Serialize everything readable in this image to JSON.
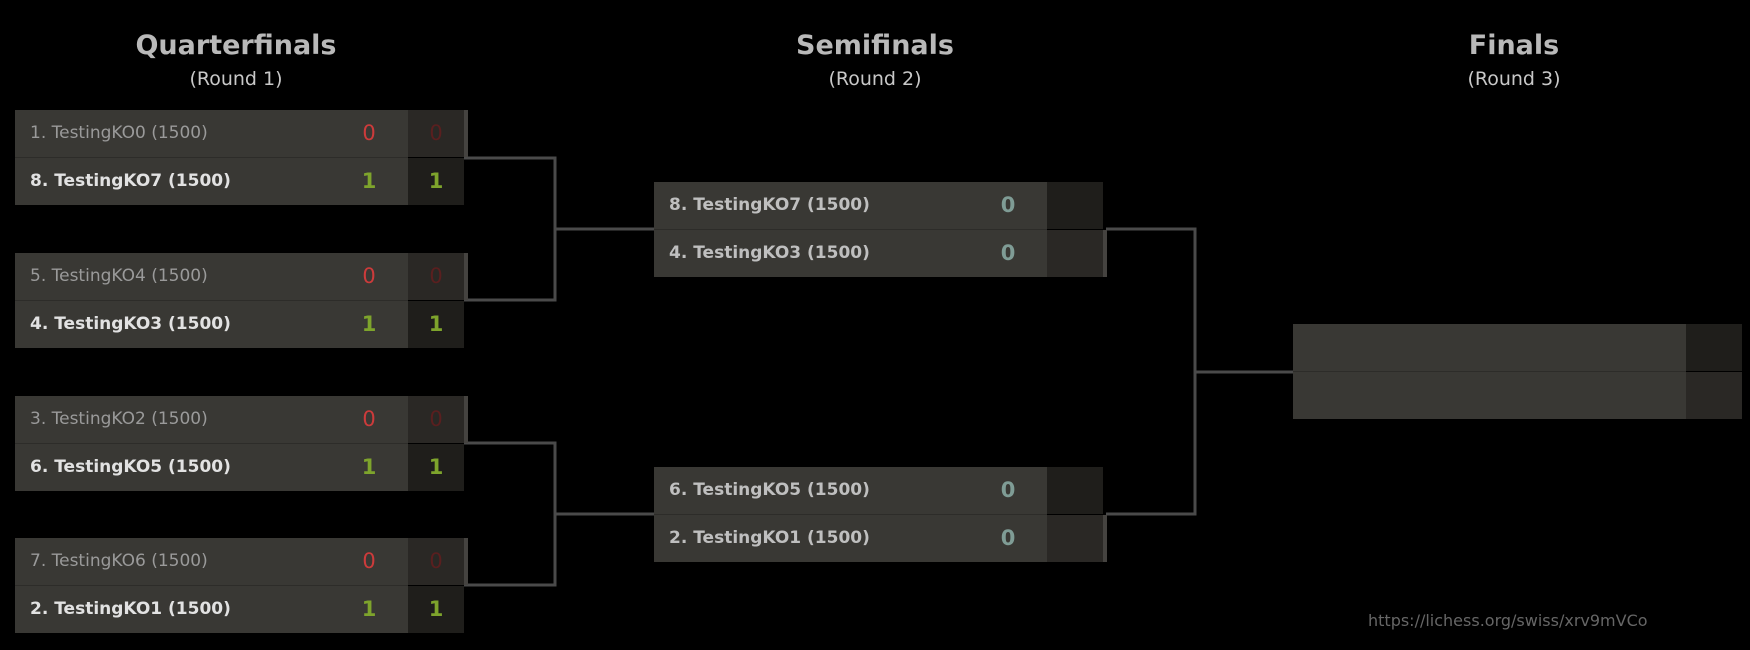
{
  "rounds": [
    {
      "title": "Quarterfinals",
      "subtitle": "(Round 1)"
    },
    {
      "title": "Semifinals",
      "subtitle": "(Round 2)"
    },
    {
      "title": "Finals",
      "subtitle": "(Round 3)"
    }
  ],
  "quarterfinals": [
    {
      "top": {
        "name": "1. TestingKO0 (1500)",
        "score": "0",
        "total": "0"
      },
      "bottom": {
        "name": "8. TestingKO7 (1500)",
        "score": "1",
        "total": "1"
      }
    },
    {
      "top": {
        "name": "5. TestingKO4 (1500)",
        "score": "0",
        "total": "0"
      },
      "bottom": {
        "name": "4. TestingKO3 (1500)",
        "score": "1",
        "total": "1"
      }
    },
    {
      "top": {
        "name": "3. TestingKO2 (1500)",
        "score": "0",
        "total": "0"
      },
      "bottom": {
        "name": "6. TestingKO5 (1500)",
        "score": "1",
        "total": "1"
      }
    },
    {
      "top": {
        "name": "7. TestingKO6 (1500)",
        "score": "0",
        "total": "0"
      },
      "bottom": {
        "name": "2. TestingKO1 (1500)",
        "score": "1",
        "total": "1"
      }
    }
  ],
  "semifinals": [
    {
      "top": {
        "name": "8. TestingKO7 (1500)",
        "score": "0"
      },
      "bottom": {
        "name": "4. TestingKO3 (1500)",
        "score": "0"
      }
    },
    {
      "top": {
        "name": "6. TestingKO5 (1500)",
        "score": "0"
      },
      "bottom": {
        "name": "2. TestingKO1 (1500)",
        "score": "0"
      }
    }
  ],
  "url": "https://lichess.org/swiss/xrv9mVCo",
  "colors": {
    "background": "#000000",
    "match": "#393834",
    "loss": "#cc3b3b",
    "win": "#7ea42c",
    "pending": "#7f9c95",
    "connector": "#4a4a4a"
  }
}
